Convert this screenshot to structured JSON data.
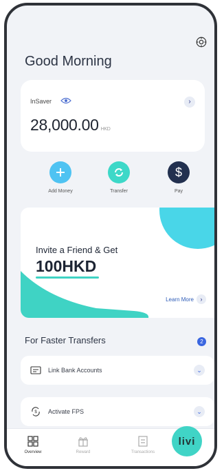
{
  "greeting": "Good Morning",
  "balance": {
    "account_label": "InSaver",
    "amount": "28,000.00",
    "currency": "HKD"
  },
  "actions": [
    {
      "label": "Add Money",
      "icon": "plus-icon",
      "color": "#4fc3f2"
    },
    {
      "label": "Transfer",
      "icon": "transfer-icon",
      "color": "#3dd8c8"
    },
    {
      "label": "Pay",
      "icon": "dollar-icon",
      "color": "#22304f"
    }
  ],
  "promo": {
    "title": "Invite a Friend & Get",
    "amount": "100HKD",
    "link_label": "Learn More"
  },
  "transfers": {
    "title": "For Faster Transfers",
    "count": "2",
    "items": [
      {
        "label": "Link Bank Accounts",
        "icon": "bank-card-icon"
      },
      {
        "label": "Activate FPS",
        "icon": "fps-icon"
      }
    ]
  },
  "nav": {
    "items": [
      {
        "label": "Overview",
        "icon": "grid-icon",
        "active": true
      },
      {
        "label": "Reward",
        "icon": "gift-icon",
        "active": false
      },
      {
        "label": "Transactions",
        "icon": "receipt-icon",
        "active": false
      }
    ],
    "fab_label": "livi"
  },
  "colors": {
    "accent_teal": "#40d4c6",
    "brand_navy": "#22304f",
    "link_blue": "#2f5db8",
    "badge_blue": "#3a66e0"
  }
}
